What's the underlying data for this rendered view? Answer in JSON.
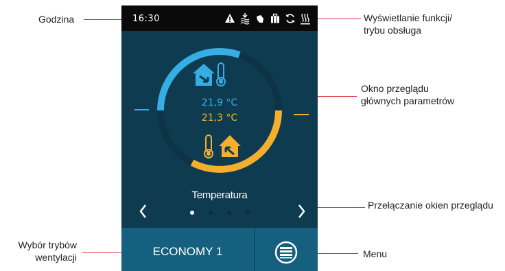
{
  "status_bar": {
    "time": "16:30",
    "icons": [
      "warning-icon",
      "heating-coil-icon",
      "hand-manual-icon",
      "suitcase-icon",
      "sync-icon",
      "heater-icon"
    ]
  },
  "overview": {
    "indoor_temp": "21,9 °C",
    "outdoor_temp": "21,3 °C",
    "title": "Temperatura",
    "page_count": 4,
    "active_page": 1
  },
  "bottom_bar": {
    "mode_label": "ECONOMY 1",
    "menu_icon": "menu-list-icon"
  },
  "callouts": {
    "time": "Godzina",
    "function_display_line1": "Wyświetlanie funkcji/",
    "function_display_line2": "trybu obsługa",
    "overview_window_line1": "Okno przeglądu",
    "overview_window_line2": "głównych parametrów",
    "switch_windows": "Przełączanie okien przeglądu",
    "mode_select_line1": "Wybór trybów",
    "mode_select_line2": "wentylacji",
    "menu": "Menu"
  },
  "colors": {
    "background": "#0f3b51",
    "status_bar": "#0a0a0a",
    "indoor": "#35aee4",
    "outdoor": "#f4b02d",
    "bottom_bar": "#15607e",
    "leader_line": "#e0303a"
  }
}
